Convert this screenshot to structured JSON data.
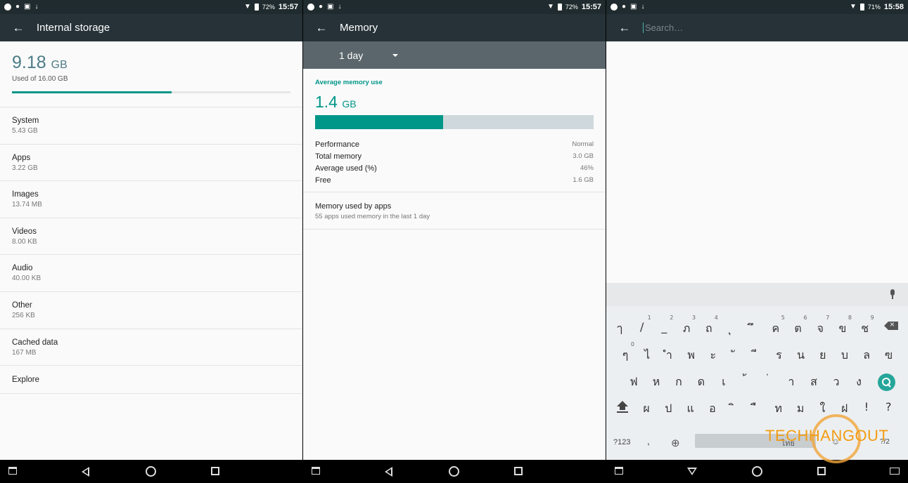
{
  "status_bars": [
    {
      "battery": "72%",
      "time": "15:57"
    },
    {
      "battery": "72%",
      "time": "15:57"
    },
    {
      "battery": "71%",
      "time": "15:58"
    }
  ],
  "storage": {
    "title": "Internal storage",
    "used_value": "9.18",
    "used_unit": "GB",
    "used_of": "Used of 16.00 GB",
    "used_fraction": 0.574,
    "categories": [
      {
        "label": "System",
        "value": "5.43 GB"
      },
      {
        "label": "Apps",
        "value": "3.22 GB"
      },
      {
        "label": "Images",
        "value": "13.74 MB"
      },
      {
        "label": "Videos",
        "value": "8.00 KB"
      },
      {
        "label": "Audio",
        "value": "40.00 KB"
      },
      {
        "label": "Other",
        "value": "256 KB"
      },
      {
        "label": "Cached data",
        "value": "167 MB"
      },
      {
        "label": "Explore"
      }
    ]
  },
  "memory": {
    "title": "Memory",
    "period": "1 day",
    "heading": "Average memory use",
    "value": "1.4",
    "unit": "GB",
    "used_fraction": 0.46,
    "stats": [
      {
        "label": "Performance",
        "value": "Normal"
      },
      {
        "label": "Total memory",
        "value": "3.0 GB"
      },
      {
        "label": "Average used (%)",
        "value": "46%"
      },
      {
        "label": "Free",
        "value": "1.6 GB"
      }
    ],
    "apps_title": "Memory used by apps",
    "apps_sub": "55 apps used memory in the last 1 day"
  },
  "search": {
    "placeholder": "Search…"
  },
  "keyboard": {
    "row1": [
      "ๅ",
      "/",
      "_",
      "ภ",
      "ถ",
      "ุ",
      "ึ",
      "ค",
      "ต",
      "จ",
      "ข",
      "ช"
    ],
    "row1_sup": [
      "",
      "1",
      "2",
      "3",
      "4",
      "",
      "",
      "5",
      "6",
      "7",
      "8",
      "9"
    ],
    "row2": [
      "ๆ",
      "ไ",
      "ำ",
      "พ",
      "ะ",
      "ั",
      "ี",
      "ร",
      "น",
      "ย",
      "บ",
      "ล",
      "ฃ"
    ],
    "row2_sup": [
      "0",
      "",
      "",
      "",
      "",
      "",
      "",
      "",
      "",
      "",
      "",
      "",
      ""
    ],
    "row3": [
      "ฟ",
      "ห",
      "ก",
      "ด",
      "เ",
      "้",
      "่",
      "า",
      "ส",
      "ว",
      "ง"
    ],
    "row4": [
      "ผ",
      "ป",
      "แ",
      "อ",
      "ิ",
      "ื",
      "ท",
      "ม",
      "ใ",
      "ฝ",
      "!",
      "?"
    ],
    "symbols_label": "?123",
    "comma": ",",
    "space_label": "ไทย",
    "mod_label": "?/2"
  },
  "watermark": {
    "text": "TECHHANGOUT"
  },
  "colors": {
    "accent": "#009688",
    "toolbar": "#263238",
    "period_bar": "#5a666b"
  }
}
